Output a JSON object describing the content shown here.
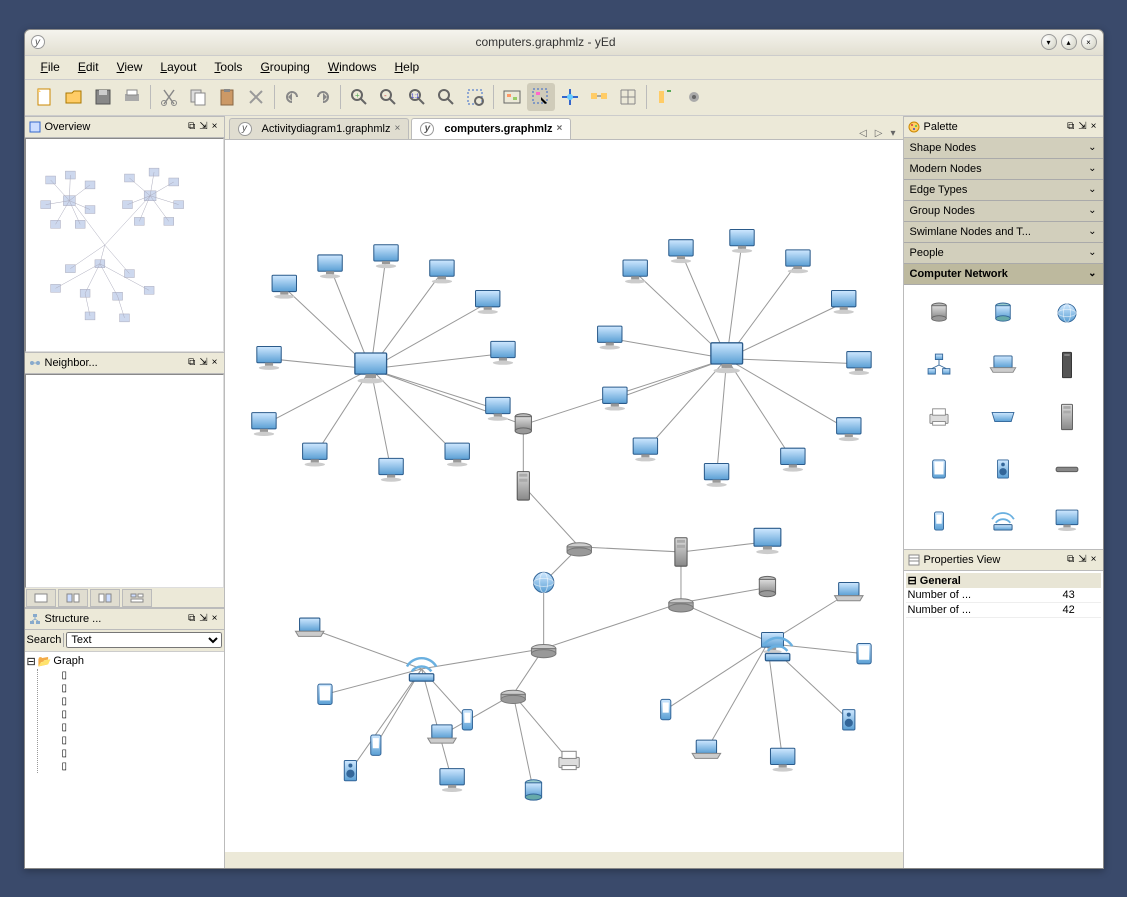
{
  "window": {
    "title": "computers.graphmlz - yEd",
    "app_icon": "y"
  },
  "menu": {
    "file": "File",
    "edit": "Edit",
    "view": "View",
    "layout": "Layout",
    "tools": "Tools",
    "grouping": "Grouping",
    "windows": "Windows",
    "help": "Help"
  },
  "panels": {
    "overview": "Overview",
    "neighborhood": "Neighbor...",
    "structure": "Structure ...",
    "palette": "Palette",
    "properties": "Properties View"
  },
  "editor": {
    "tabs": [
      {
        "label": "Activitydiagram1.graphmlz",
        "active": false
      },
      {
        "label": "computers.graphmlz",
        "active": true
      }
    ]
  },
  "structure": {
    "search_label": "Search",
    "search_mode": "Text",
    "root": "Graph",
    "no_value": "<No Value>",
    "item_count": 8
  },
  "palette": {
    "categories": [
      "Shape Nodes",
      "Modern Nodes",
      "Edge Types",
      "Group Nodes",
      "Swimlane Nodes and T...",
      "People",
      "Computer Network"
    ],
    "selected": "Computer Network"
  },
  "properties": {
    "group": "General",
    "rows": [
      {
        "key": "Number of ...",
        "val": "43"
      },
      {
        "key": "Number of ...",
        "val": "42"
      }
    ]
  }
}
